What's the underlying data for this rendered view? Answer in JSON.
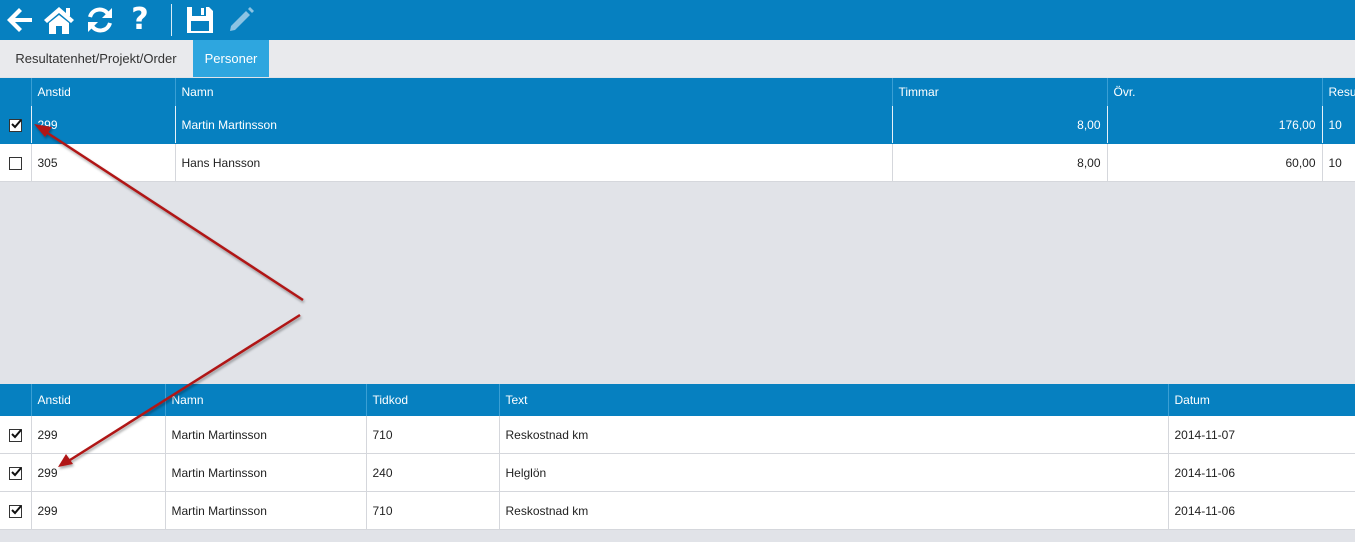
{
  "toolbar": {
    "icons": [
      "arrow-left-icon",
      "home-icon",
      "refresh-icon",
      "help-icon",
      "save-icon",
      "pencil-icon"
    ],
    "help_label": "?"
  },
  "tabs": [
    {
      "label": "Resultatenhet/Projekt/Order",
      "active": false
    },
    {
      "label": "Personer",
      "active": true
    }
  ],
  "top_table": {
    "columns": [
      "Anstid",
      "Namn",
      "Timmar",
      "Övr.",
      "Resul"
    ],
    "rows": [
      {
        "checked": true,
        "anstid": "299",
        "namn": "Martin Martinsson",
        "timmar": "8,00",
        "ovr": "176,00",
        "resul": "10"
      },
      {
        "checked": false,
        "anstid": "305",
        "namn": "Hans Hansson",
        "timmar": "8,00",
        "ovr": "60,00",
        "resul": "10"
      }
    ]
  },
  "bottom_table": {
    "columns": [
      "Anstid",
      "Namn",
      "Tidkod",
      "Text",
      "Datum"
    ],
    "rows": [
      {
        "checked": true,
        "anstid": "299",
        "namn": "Martin Martinsson",
        "tidkod": "710",
        "text": "Reskostnad km",
        "datum": "2014-11-07"
      },
      {
        "checked": true,
        "anstid": "299",
        "namn": "Martin Martinsson",
        "tidkod": "240",
        "text": "Helglön",
        "datum": "2014-11-06"
      },
      {
        "checked": true,
        "anstid": "299",
        "namn": "Martin Martinsson",
        "tidkod": "710",
        "text": "Reskostnad km",
        "datum": "2014-11-06"
      }
    ]
  },
  "colors": {
    "primary": "#0680c0",
    "active_tab": "#2ea6df",
    "annotation_arrow": "#b01818",
    "background": "#e1e3e8"
  }
}
